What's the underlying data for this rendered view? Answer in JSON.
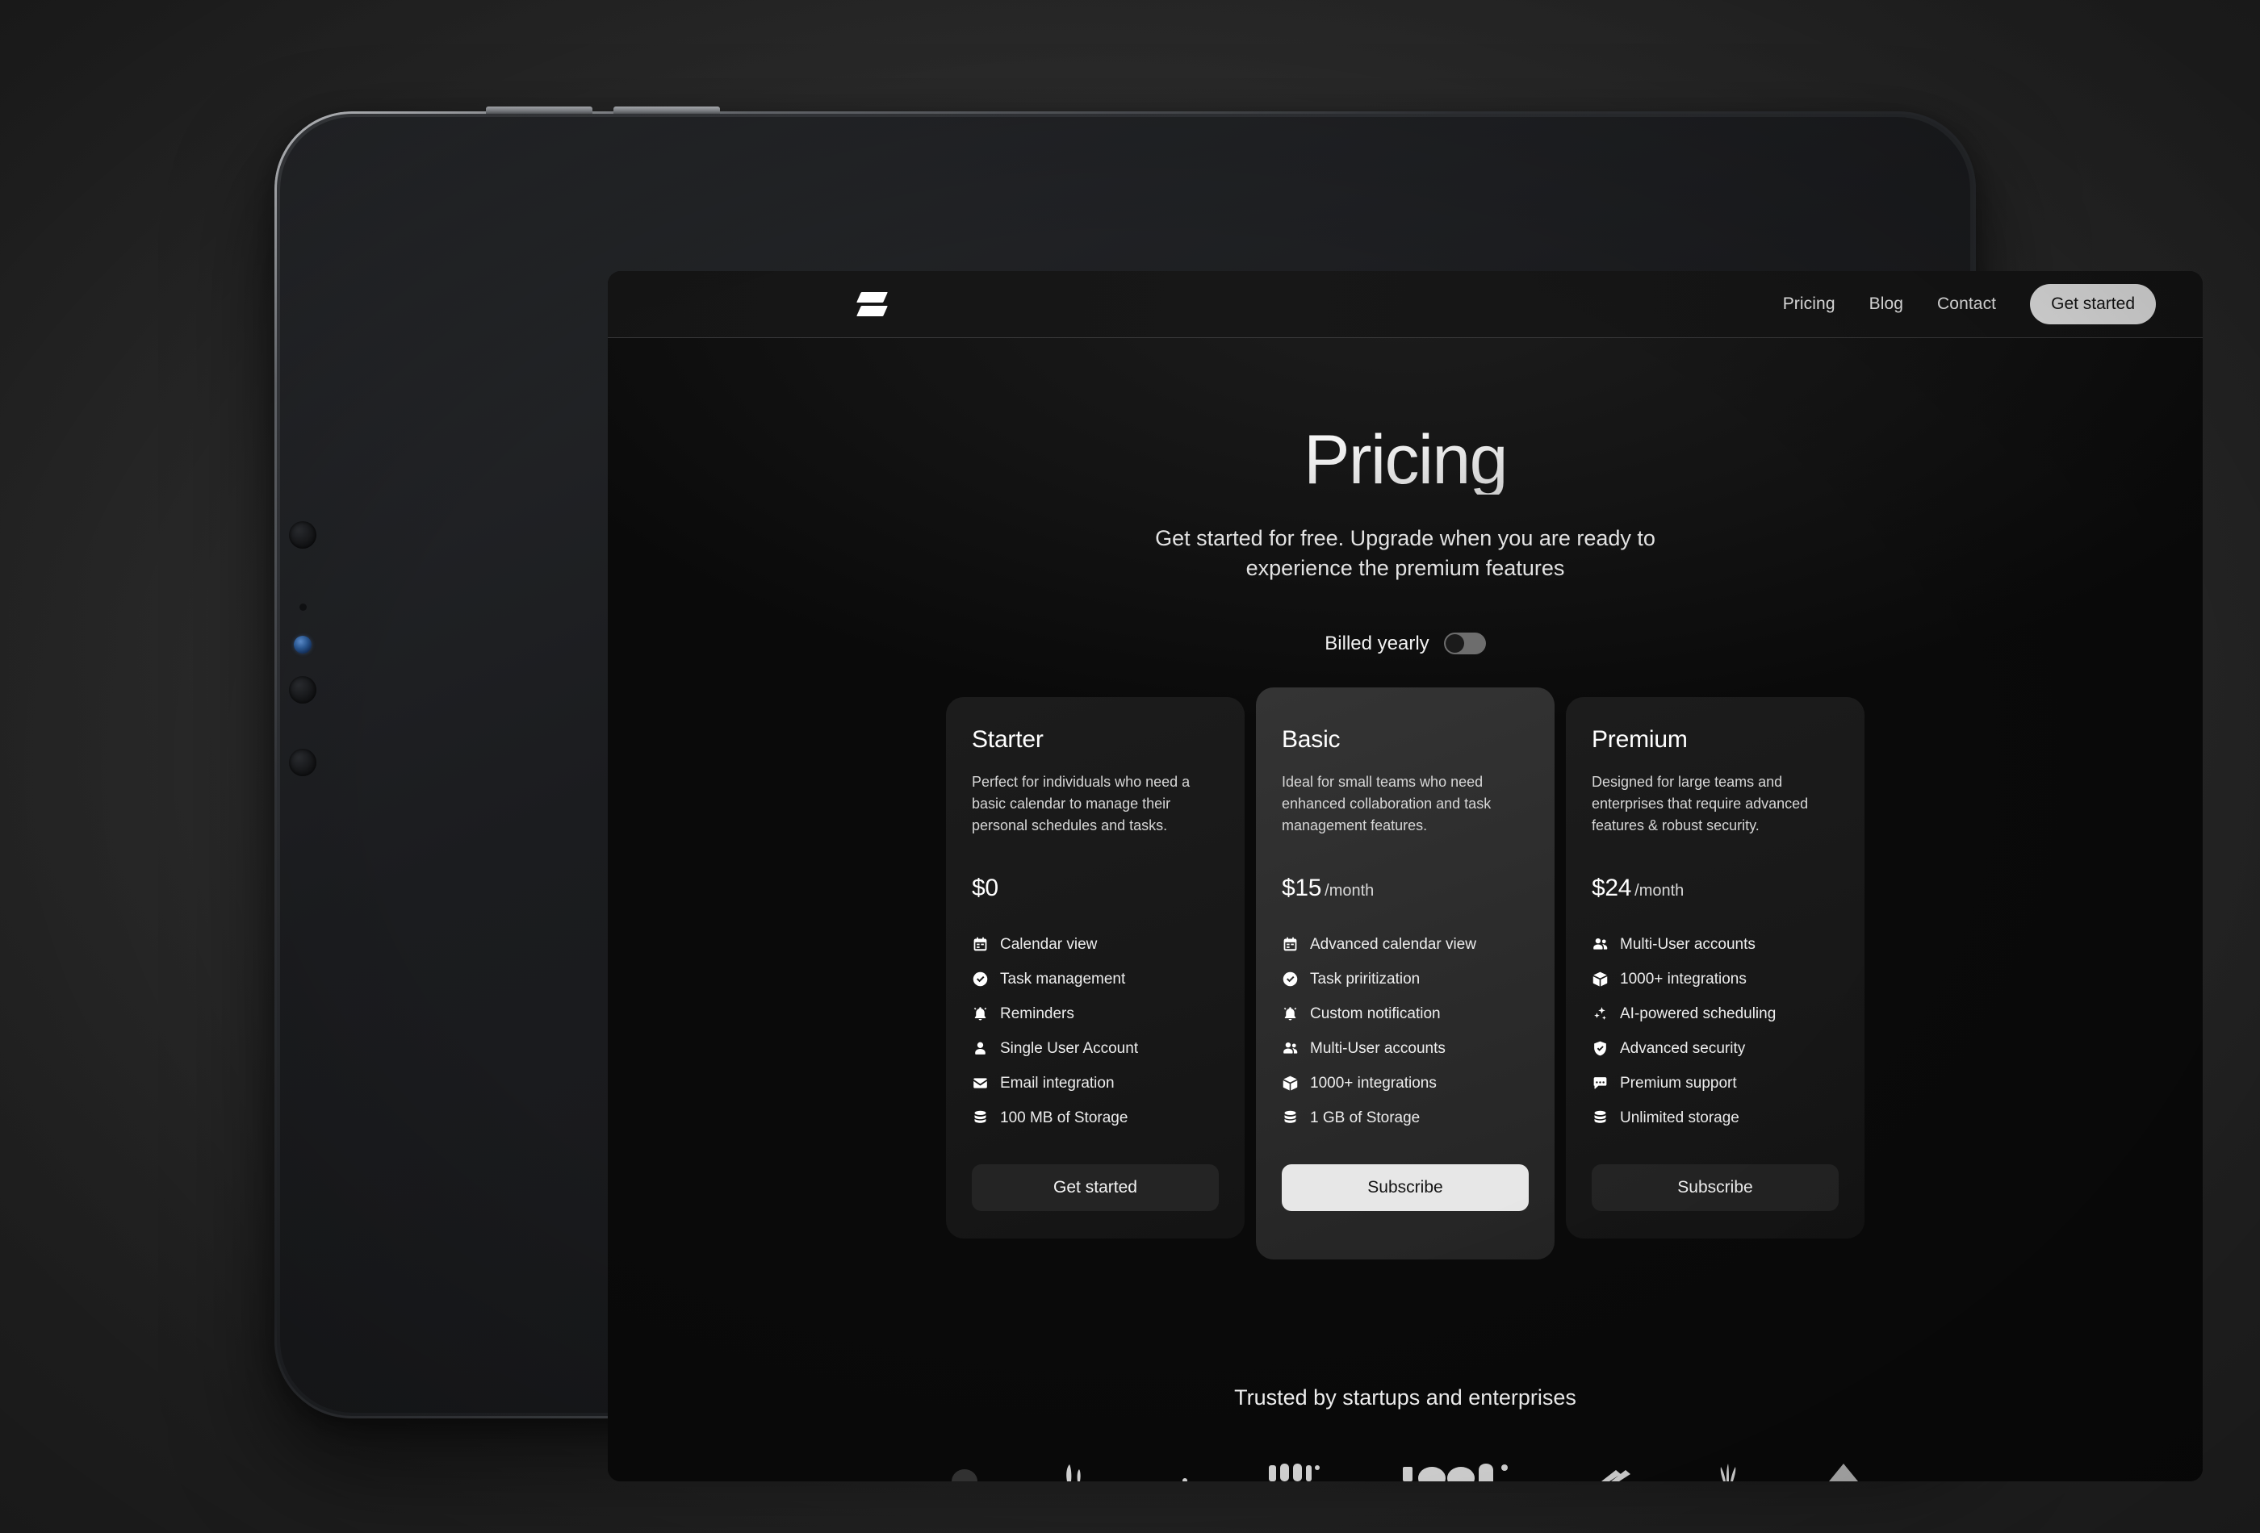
{
  "header": {
    "logo_icon": "brand-parallelogram-logo",
    "nav": [
      {
        "label": "Pricing"
      },
      {
        "label": "Blog"
      },
      {
        "label": "Contact"
      }
    ],
    "cta_label": "Get started"
  },
  "hero": {
    "title": "Pricing",
    "subtitle": "Get started for free. Upgrade when you are ready to experience the premium features"
  },
  "billing": {
    "label": "Billed yearly",
    "toggle_state": "off"
  },
  "plans": [
    {
      "name": "Starter",
      "description": "Perfect for individuals who need a basic calendar to manage their personal schedules and tasks.",
      "price": "$0",
      "period": "",
      "featured": false,
      "cta_label": "Get started",
      "cta_style": "dark",
      "features": [
        {
          "icon": "calendar-icon",
          "label": "Calendar view"
        },
        {
          "icon": "check-circle-icon",
          "label": "Task management"
        },
        {
          "icon": "bell-icon",
          "label": "Reminders"
        },
        {
          "icon": "person-icon",
          "label": "Single User Account"
        },
        {
          "icon": "envelope-icon",
          "label": "Email integration"
        },
        {
          "icon": "database-icon",
          "label": "100 MB of Storage"
        }
      ]
    },
    {
      "name": "Basic",
      "description": "Ideal for small teams who need enhanced collaboration and task management features.",
      "price": "$15",
      "period": "/month",
      "featured": true,
      "cta_label": "Subscribe",
      "cta_style": "light",
      "features": [
        {
          "icon": "calendar-icon",
          "label": "Advanced calendar view"
        },
        {
          "icon": "check-circle-icon",
          "label": "Task priritization"
        },
        {
          "icon": "bell-icon",
          "label": "Custom notification"
        },
        {
          "icon": "people-icon",
          "label": "Multi-User accounts"
        },
        {
          "icon": "box-icon",
          "label": "1000+ integrations"
        },
        {
          "icon": "database-icon",
          "label": "1 GB of Storage"
        }
      ]
    },
    {
      "name": "Premium",
      "description": "Designed for large teams and enterprises that require advanced features & robust security.",
      "price": "$24",
      "period": "/month",
      "featured": false,
      "cta_label": "Subscribe",
      "cta_style": "dark",
      "features": [
        {
          "icon": "people-icon",
          "label": "Multi-User accounts"
        },
        {
          "icon": "box-icon",
          "label": "1000+ integrations"
        },
        {
          "icon": "sparkles-icon",
          "label": "AI-powered scheduling"
        },
        {
          "icon": "shield-check-icon",
          "label": "Advanced security"
        },
        {
          "icon": "chat-icon",
          "label": "Premium support"
        },
        {
          "icon": "database-icon",
          "label": "Unlimited storage"
        }
      ]
    }
  ],
  "trusted": {
    "heading": "Trusted by startups and enterprises",
    "logos": [
      {
        "name": "logo-dome-mark"
      },
      {
        "name": "logo-leaf-mark"
      },
      {
        "name": "logo-dot-mark"
      },
      {
        "name": "logo-wordmark-m"
      },
      {
        "name": "logo-wordmark-logoipsum"
      },
      {
        "name": "logo-slash-mark"
      },
      {
        "name": "logo-burst-mark"
      },
      {
        "name": "logo-triangle-mark"
      }
    ]
  },
  "colors": {
    "accent_light": "#e7e7e7",
    "card_dark": "#1a1a1a",
    "card_featured": "#2e2e2e",
    "page_background": "#0a0a0a"
  }
}
